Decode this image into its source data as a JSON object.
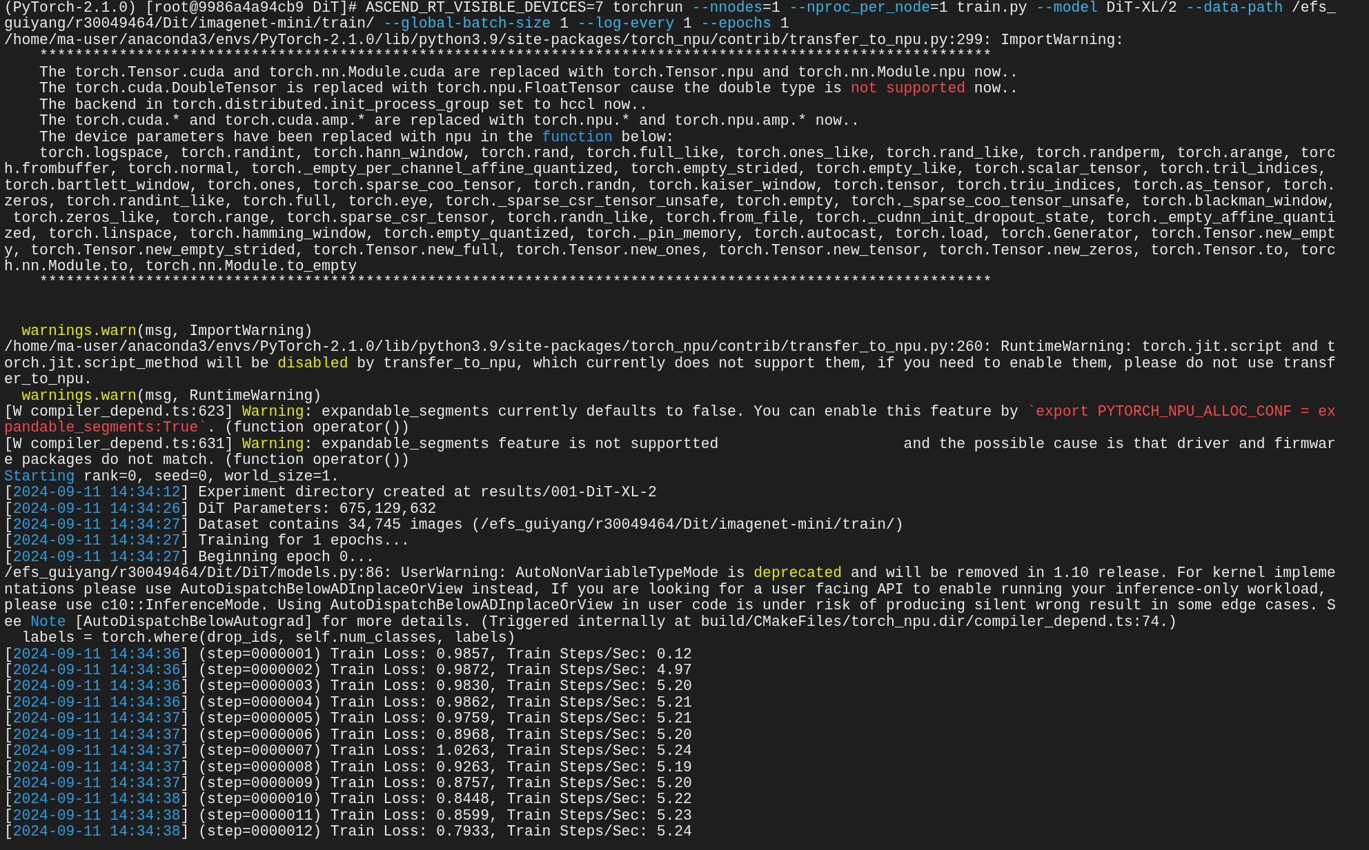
{
  "terminal": {
    "lines": [
      {
        "kind": "text",
        "segments": [
          {
            "text": "(PyTorch-2.1.0) [root@9986a4a94cb9 DiT]# ASCEND_RT_VISIBLE_DEVICES=7 torchrun ",
            "kind": "plain"
          },
          {
            "text": "--nnodes",
            "kind": "option"
          },
          {
            "text": "=1 ",
            "kind": "plain"
          },
          {
            "text": "--nproc_per_node",
            "kind": "option"
          },
          {
            "text": "=1 train.py ",
            "kind": "plain"
          },
          {
            "text": "--model",
            "kind": "option"
          },
          {
            "text": " DiT-XL/2 ",
            "kind": "plain"
          },
          {
            "text": "--data-path",
            "kind": "option"
          },
          {
            "text": " /efs_",
            "kind": "plain"
          }
        ]
      },
      {
        "kind": "text",
        "segments": [
          {
            "text": "guiyang/r30049464/Dit/imagenet-mini/train/ ",
            "kind": "plain"
          },
          {
            "text": "--global-batch-size",
            "kind": "option"
          },
          {
            "text": " 1 ",
            "kind": "plain"
          },
          {
            "text": "--log-every",
            "kind": "option"
          },
          {
            "text": " 1 ",
            "kind": "plain"
          },
          {
            "text": "--epochs",
            "kind": "option"
          },
          {
            "text": " 1",
            "kind": "plain"
          }
        ]
      },
      {
        "kind": "text",
        "segments": [
          {
            "text": "/home/ma-user/anaconda3/envs/PyTorch-2.1.0/lib/python3.9/site-packages/torch_npu/contrib/transfer_to_npu.py:299: ImportWarning:",
            "kind": "plain"
          }
        ]
      },
      {
        "kind": "text",
        "segments": [
          {
            "text": "    ************************************************************************************************************",
            "kind": "plain"
          }
        ]
      },
      {
        "kind": "text",
        "segments": [
          {
            "text": "    The torch.Tensor.cuda and torch.nn.Module.cuda are replaced with torch.Tensor.npu and torch.nn.Module.npu now..",
            "kind": "plain"
          }
        ]
      },
      {
        "kind": "text",
        "segments": [
          {
            "text": "    The torch.cuda.DoubleTensor is replaced with torch.npu.FloatTensor cause the double type is ",
            "kind": "plain"
          },
          {
            "text": "not supported",
            "kind": "error"
          },
          {
            "text": " now..",
            "kind": "plain"
          }
        ]
      },
      {
        "kind": "text",
        "segments": [
          {
            "text": "    The backend in torch.distributed.init_process_group set to hccl now..",
            "kind": "plain"
          }
        ]
      },
      {
        "kind": "text",
        "segments": [
          {
            "text": "    The torch.cuda.* and torch.cuda.amp.* are replaced with torch.npu.* and torch.npu.amp.* now..",
            "kind": "plain"
          }
        ]
      },
      {
        "kind": "text",
        "segments": [
          {
            "text": "    The device parameters have been replaced with npu in the ",
            "kind": "plain"
          },
          {
            "text": "function",
            "kind": "keyword"
          },
          {
            "text": " below:",
            "kind": "plain"
          }
        ]
      },
      {
        "kind": "text",
        "segments": [
          {
            "text": "    torch.logspace, torch.randint, torch.hann_window, torch.rand, torch.full_like, torch.ones_like, torch.rand_like, torch.randperm, torch.arange, torc",
            "kind": "plain"
          }
        ]
      },
      {
        "kind": "text",
        "segments": [
          {
            "text": "h.frombuffer, torch.normal, torch._empty_per_channel_affine_quantized, torch.empty_strided, torch.empty_like, torch.scalar_tensor, torch.tril_indices,",
            "kind": "plain"
          }
        ]
      },
      {
        "kind": "text",
        "segments": [
          {
            "text": "torch.bartlett_window, torch.ones, torch.sparse_coo_tensor, torch.randn, torch.kaiser_window, torch.tensor, torch.triu_indices, torch.as_tensor, torch.",
            "kind": "plain"
          }
        ]
      },
      {
        "kind": "text",
        "segments": [
          {
            "text": "zeros, torch.randint_like, torch.full, torch.eye, torch._sparse_csr_tensor_unsafe, torch.empty, torch._sparse_coo_tensor_unsafe, torch.blackman_window,",
            "kind": "plain"
          }
        ]
      },
      {
        "kind": "text",
        "segments": [
          {
            "text": " torch.zeros_like, torch.range, torch.sparse_csr_tensor, torch.randn_like, torch.from_file, torch._cudnn_init_dropout_state, torch._empty_affine_quanti",
            "kind": "plain"
          }
        ]
      },
      {
        "kind": "text",
        "segments": [
          {
            "text": "zed, torch.linspace, torch.hamming_window, torch.empty_quantized, torch._pin_memory, torch.autocast, torch.load, torch.Generator, torch.Tensor.new_empt",
            "kind": "plain"
          }
        ]
      },
      {
        "kind": "text",
        "segments": [
          {
            "text": "y, torch.Tensor.new_empty_strided, torch.Tensor.new_full, torch.Tensor.new_ones, torch.Tensor.new_tensor, torch.Tensor.new_zeros, torch.Tensor.to, torc",
            "kind": "plain"
          }
        ]
      },
      {
        "kind": "text",
        "segments": [
          {
            "text": "h.nn.Module.to, torch.nn.Module.to_empty",
            "kind": "plain"
          }
        ]
      },
      {
        "kind": "text",
        "segments": [
          {
            "text": "    ************************************************************************************************************",
            "kind": "plain"
          }
        ]
      },
      {
        "kind": "blank"
      },
      {
        "kind": "blank"
      },
      {
        "kind": "text",
        "segments": [
          {
            "text": "  warnings.warn",
            "kind": "warning"
          },
          {
            "text": "(msg, ImportWarning)",
            "kind": "plain"
          }
        ]
      },
      {
        "kind": "text",
        "segments": [
          {
            "text": "/home/ma-user/anaconda3/envs/PyTorch-2.1.0/lib/python3.9/site-packages/torch_npu/contrib/transfer_to_npu.py:260: RuntimeWarning: torch.jit.script and t",
            "kind": "plain"
          }
        ]
      },
      {
        "kind": "text",
        "segments": [
          {
            "text": "orch.jit.script_method will be ",
            "kind": "plain"
          },
          {
            "text": "disabled",
            "kind": "warning"
          },
          {
            "text": " by transfer_to_npu, which currently does not support them, if you need to enable them, please do not use transf",
            "kind": "plain"
          }
        ]
      },
      {
        "kind": "text",
        "segments": [
          {
            "text": "er_to_npu.",
            "kind": "plain"
          }
        ]
      },
      {
        "kind": "text",
        "segments": [
          {
            "text": "  warnings.warn",
            "kind": "warning"
          },
          {
            "text": "(msg, RuntimeWarning)",
            "kind": "plain"
          }
        ]
      },
      {
        "kind": "text",
        "segments": [
          {
            "text": "[W compiler_depend.ts:623] ",
            "kind": "plain"
          },
          {
            "text": "Warning",
            "kind": "warning"
          },
          {
            "text": ": expandable_segments currently defaults to false. You can enable this feature by ",
            "kind": "plain"
          },
          {
            "text": "`export PYTORCH_NPU_ALLOC_CONF = ex",
            "kind": "error"
          }
        ]
      },
      {
        "kind": "text",
        "segments": [
          {
            "text": "pandable_segments:True`",
            "kind": "error"
          },
          {
            "text": ". (function operator())",
            "kind": "plain"
          }
        ]
      },
      {
        "kind": "text",
        "segments": [
          {
            "text": "[W compiler_depend.ts:631] ",
            "kind": "plain"
          },
          {
            "text": "Warning",
            "kind": "warning"
          },
          {
            "text": ": expandable_segments feature is not supportted                     and the possible cause is that driver and firmwar",
            "kind": "plain"
          }
        ]
      },
      {
        "kind": "text",
        "segments": [
          {
            "text": "e packages do not match. (function operator())",
            "kind": "plain"
          }
        ]
      },
      {
        "kind": "text",
        "segments": [
          {
            "text": "Starting",
            "kind": "keyword"
          },
          {
            "text": " rank=0, seed=0, world_size=1.",
            "kind": "plain"
          }
        ]
      },
      {
        "kind": "text",
        "segments": [
          {
            "text": "[",
            "kind": "plain"
          },
          {
            "text": "2024-09-11 14:34:12",
            "kind": "keyword"
          },
          {
            "text": "] Experiment directory created at results/001-DiT-XL-2",
            "kind": "plain"
          }
        ]
      },
      {
        "kind": "text",
        "segments": [
          {
            "text": "[",
            "kind": "plain"
          },
          {
            "text": "2024-09-11 14:34:26",
            "kind": "keyword"
          },
          {
            "text": "] DiT Parameters: 675,129,632",
            "kind": "plain"
          }
        ]
      },
      {
        "kind": "text",
        "segments": [
          {
            "text": "[",
            "kind": "plain"
          },
          {
            "text": "2024-09-11 14:34:27",
            "kind": "keyword"
          },
          {
            "text": "] Dataset contains 34,745 images (/efs_guiyang/r30049464/Dit/imagenet-mini/train/)",
            "kind": "plain"
          }
        ]
      },
      {
        "kind": "text",
        "segments": [
          {
            "text": "[",
            "kind": "plain"
          },
          {
            "text": "2024-09-11 14:34:27",
            "kind": "keyword"
          },
          {
            "text": "] Training for 1 epochs...",
            "kind": "plain"
          }
        ]
      },
      {
        "kind": "text",
        "segments": [
          {
            "text": "[",
            "kind": "plain"
          },
          {
            "text": "2024-09-11 14:34:27",
            "kind": "keyword"
          },
          {
            "text": "] Beginning epoch 0...",
            "kind": "plain"
          }
        ]
      },
      {
        "kind": "text",
        "segments": [
          {
            "text": "/efs_guiyang/r30049464/Dit/DiT/models.py:86: UserWarning: AutoNonVariableTypeMode is ",
            "kind": "plain"
          },
          {
            "text": "deprecated",
            "kind": "warning"
          },
          {
            "text": " and will be removed in 1.10 release. For kernel impleme",
            "kind": "plain"
          }
        ]
      },
      {
        "kind": "text",
        "segments": [
          {
            "text": "ntations please use AutoDispatchBelowADInplaceOrView instead, If you are looking for a user facing API to enable running your inference-only workload,",
            "kind": "plain"
          }
        ]
      },
      {
        "kind": "text",
        "segments": [
          {
            "text": "please use c10::InferenceMode. Using AutoDispatchBelowADInplaceOrView in user code is under risk of producing silent wrong result in some edge cases. S",
            "kind": "plain"
          }
        ]
      },
      {
        "kind": "text",
        "segments": [
          {
            "text": "ee ",
            "kind": "plain"
          },
          {
            "text": "Note",
            "kind": "keyword"
          },
          {
            "text": " [AutoDispatchBelowAutograd] for more details. (Triggered internally at build/CMakeFiles/torch_npu.dir/compiler_depend.ts:74.)",
            "kind": "plain"
          }
        ]
      },
      {
        "kind": "text",
        "segments": [
          {
            "text": "  labels = torch.where(drop_ids, self.num_classes, labels)",
            "kind": "plain"
          }
        ]
      },
      {
        "kind": "text",
        "segments": [
          {
            "text": "[",
            "kind": "plain"
          },
          {
            "text": "2024-09-11 14:34:36",
            "kind": "keyword"
          },
          {
            "text": "] (step=0000001) Train Loss: 0.9857, Train Steps/Sec: 0.12",
            "kind": "plain"
          }
        ]
      },
      {
        "kind": "text",
        "segments": [
          {
            "text": "[",
            "kind": "plain"
          },
          {
            "text": "2024-09-11 14:34:36",
            "kind": "keyword"
          },
          {
            "text": "] (step=0000002) Train Loss: 0.9872, Train Steps/Sec: 4.97",
            "kind": "plain"
          }
        ]
      },
      {
        "kind": "text",
        "segments": [
          {
            "text": "[",
            "kind": "plain"
          },
          {
            "text": "2024-09-11 14:34:36",
            "kind": "keyword"
          },
          {
            "text": "] (step=0000003) Train Loss: 0.9830, Train Steps/Sec: 5.20",
            "kind": "plain"
          }
        ]
      },
      {
        "kind": "text",
        "segments": [
          {
            "text": "[",
            "kind": "plain"
          },
          {
            "text": "2024-09-11 14:34:36",
            "kind": "keyword"
          },
          {
            "text": "] (step=0000004) Train Loss: 0.9862, Train Steps/Sec: 5.21",
            "kind": "plain"
          }
        ]
      },
      {
        "kind": "text",
        "segments": [
          {
            "text": "[",
            "kind": "plain"
          },
          {
            "text": "2024-09-11 14:34:37",
            "kind": "keyword"
          },
          {
            "text": "] (step=0000005) Train Loss: 0.9759, Train Steps/Sec: 5.21",
            "kind": "plain"
          }
        ]
      },
      {
        "kind": "text",
        "segments": [
          {
            "text": "[",
            "kind": "plain"
          },
          {
            "text": "2024-09-11 14:34:37",
            "kind": "keyword"
          },
          {
            "text": "] (step=0000006) Train Loss: 0.8968, Train Steps/Sec: 5.20",
            "kind": "plain"
          }
        ]
      },
      {
        "kind": "text",
        "segments": [
          {
            "text": "[",
            "kind": "plain"
          },
          {
            "text": "2024-09-11 14:34:37",
            "kind": "keyword"
          },
          {
            "text": "] (step=0000007) Train Loss: 1.0263, Train Steps/Sec: 5.24",
            "kind": "plain"
          }
        ]
      },
      {
        "kind": "text",
        "segments": [
          {
            "text": "[",
            "kind": "plain"
          },
          {
            "text": "2024-09-11 14:34:37",
            "kind": "keyword"
          },
          {
            "text": "] (step=0000008) Train Loss: 0.9263, Train Steps/Sec: 5.19",
            "kind": "plain"
          }
        ]
      },
      {
        "kind": "text",
        "segments": [
          {
            "text": "[",
            "kind": "plain"
          },
          {
            "text": "2024-09-11 14:34:37",
            "kind": "keyword"
          },
          {
            "text": "] (step=0000009) Train Loss: 0.8757, Train Steps/Sec: 5.20",
            "kind": "plain"
          }
        ]
      },
      {
        "kind": "text",
        "segments": [
          {
            "text": "[",
            "kind": "plain"
          },
          {
            "text": "2024-09-11 14:34:38",
            "kind": "keyword"
          },
          {
            "text": "] (step=0000010) Train Loss: 0.8448, Train Steps/Sec: 5.22",
            "kind": "plain"
          }
        ]
      },
      {
        "kind": "text",
        "segments": [
          {
            "text": "[",
            "kind": "plain"
          },
          {
            "text": "2024-09-11 14:34:38",
            "kind": "keyword"
          },
          {
            "text": "] (step=0000011) Train Loss: 0.8599, Train Steps/Sec: 5.23",
            "kind": "plain"
          }
        ]
      },
      {
        "kind": "text",
        "segments": [
          {
            "text": "[",
            "kind": "plain"
          },
          {
            "text": "2024-09-11 14:34:38",
            "kind": "keyword"
          },
          {
            "text": "] (step=0000012) Train Loss: 0.7933, Train Steps/Sec: 5.24",
            "kind": "plain"
          }
        ]
      }
    ]
  }
}
